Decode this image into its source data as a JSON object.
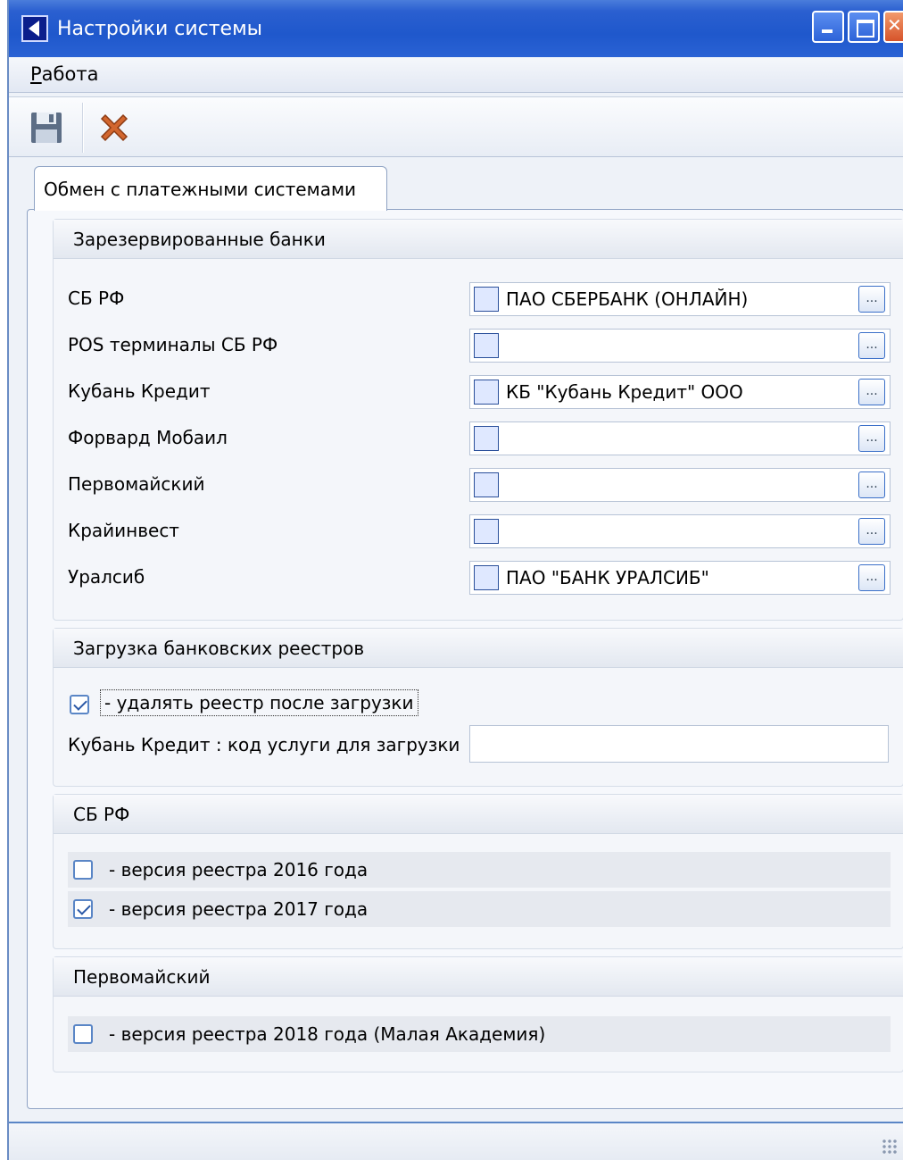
{
  "window": {
    "title": "Настройки системы"
  },
  "menu": {
    "items": [
      {
        "label_first": "Р",
        "label_rest": "абота"
      }
    ]
  },
  "toolbar": {
    "buttons": [
      {
        "icon": "save-icon"
      },
      {
        "icon": "cancel-icon"
      }
    ]
  },
  "tabs": [
    {
      "label": "Обмен с платежными системами",
      "active": true
    }
  ],
  "groups": {
    "reserved_banks": {
      "title": "Зарезервированные банки",
      "rows": [
        {
          "label": "СБ РФ",
          "value": "ПАО СБЕРБАНК (ОНЛАЙН)"
        },
        {
          "label": "POS терминалы СБ РФ",
          "value": ""
        },
        {
          "label": "Кубань Кредит",
          "value": "КБ \"Кубань Кредит\" ООО"
        },
        {
          "label": "Форвард Мобаил",
          "value": ""
        },
        {
          "label": "Первомайский",
          "value": ""
        },
        {
          "label": "Крайинвест",
          "value": ""
        },
        {
          "label": "Уралсиб",
          "value": "ПАО \"БАНК УРАЛСИБ\""
        }
      ],
      "ellipsis": "..."
    },
    "registry_load": {
      "title": "Загрузка банковских реестров",
      "delete_after_load": {
        "label": "- удалять реестр после загрузки",
        "checked": true
      },
      "kuban_code": {
        "label": "Кубань Кредит : код услуги для загрузки",
        "value": ""
      }
    },
    "sbrf": {
      "title": "СБ РФ",
      "options": [
        {
          "label": "- версия реестра 2016 года",
          "checked": false
        },
        {
          "label": "- версия реестра 2017 года",
          "checked": true
        }
      ]
    },
    "pervomaisky": {
      "title": "Первомайский",
      "options": [
        {
          "label": "- версия реестра 2018 года (Малая Академия)",
          "checked": false
        }
      ]
    }
  },
  "colors": {
    "titlebar": "#2a5fd0",
    "panel_border": "#8fa3c4",
    "accent": "#5a86c6"
  }
}
